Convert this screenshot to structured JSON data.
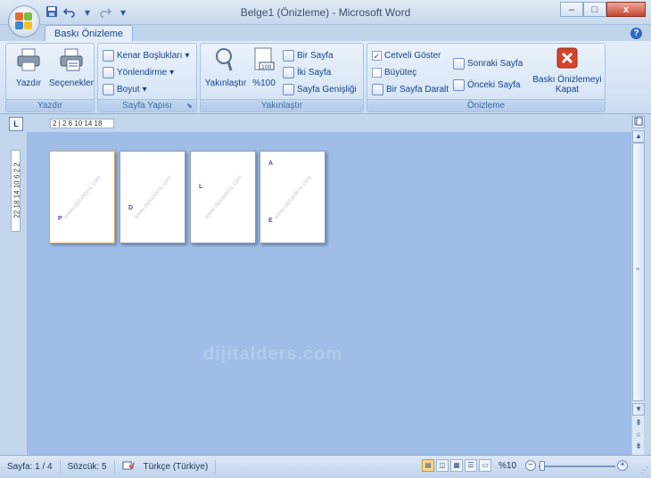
{
  "window": {
    "title": "Belge1 (Önizleme) - Microsoft Word",
    "controls": {
      "minimize": "–",
      "maximize": "□",
      "close": "x"
    }
  },
  "quick_access": {
    "save": "save-icon",
    "undo": "undo-icon",
    "redo": "redo-icon",
    "customize": "▾"
  },
  "tabs": [
    {
      "label": "Baskı Önizleme",
      "active": true
    }
  ],
  "help_glyph": "?",
  "ribbon": {
    "groups": {
      "print": {
        "label": "Yazdır",
        "buttons": {
          "print": "Yazdır",
          "options": "Seçenekler"
        }
      },
      "page_setup": {
        "label": "Sayfa Yapısı",
        "buttons": {
          "margins": "Kenar Boşlukları",
          "orientation": "Yönlendirme",
          "size": "Boyut"
        },
        "dropdown_glyph": "▾",
        "launcher": "⬊"
      },
      "zoom": {
        "label": "Yakınlaştır",
        "buttons": {
          "zoom": "Yakınlaştır",
          "hundred": "%100",
          "one_page": "Bir Sayfa",
          "two_pages": "İki Sayfa",
          "page_width": "Sayfa Genişliği"
        },
        "hundred_icon_text": "100"
      },
      "preview": {
        "label": "Önizleme",
        "checkboxes": {
          "show_ruler": "Cetveli Göster",
          "magnifier": "Büyüteç"
        },
        "check_glyph": "✓",
        "buttons": {
          "shrink_one_page": "Bir Sayfa Daralt",
          "next_page": "Sonraki Sayfa",
          "previous_page": "Önceki Sayfa",
          "close_preview": "Baskı Önizlemeyi Kapat"
        }
      }
    }
  },
  "rulers": {
    "horizontal": "2 | 2  6  10  14  18",
    "vertical": "22 18 14 10 6 2 2",
    "toggle_glyph": "L"
  },
  "pages": [
    {
      "letter": "P",
      "watermark": "www.dijitalders.com"
    },
    {
      "letter": "D",
      "watermark": "www.dijitalders.com"
    },
    {
      "letter": "L",
      "watermark": "www.dijitalders.com"
    },
    {
      "letter_top": "A",
      "letter": "E",
      "watermark": "www.dijitalders.com"
    }
  ],
  "watermark": "dijitalders.com",
  "scrollbar": {
    "up": "▲",
    "down": "▼",
    "prev_browse": "⇞",
    "select_browse": "○",
    "next_browse": "⇟",
    "grip": "≡"
  },
  "status": {
    "page": "Sayfa: 1 / 4",
    "words": "Sözcük: 5",
    "language": "Türkçe (Türkiye)",
    "zoom": "%10",
    "zoom_minus": "−",
    "zoom_plus": "+",
    "size_grip": "⋰",
    "views": [
      "▤",
      "◫",
      "▦",
      "☰",
      "▭"
    ],
    "active_view_index": 0
  }
}
